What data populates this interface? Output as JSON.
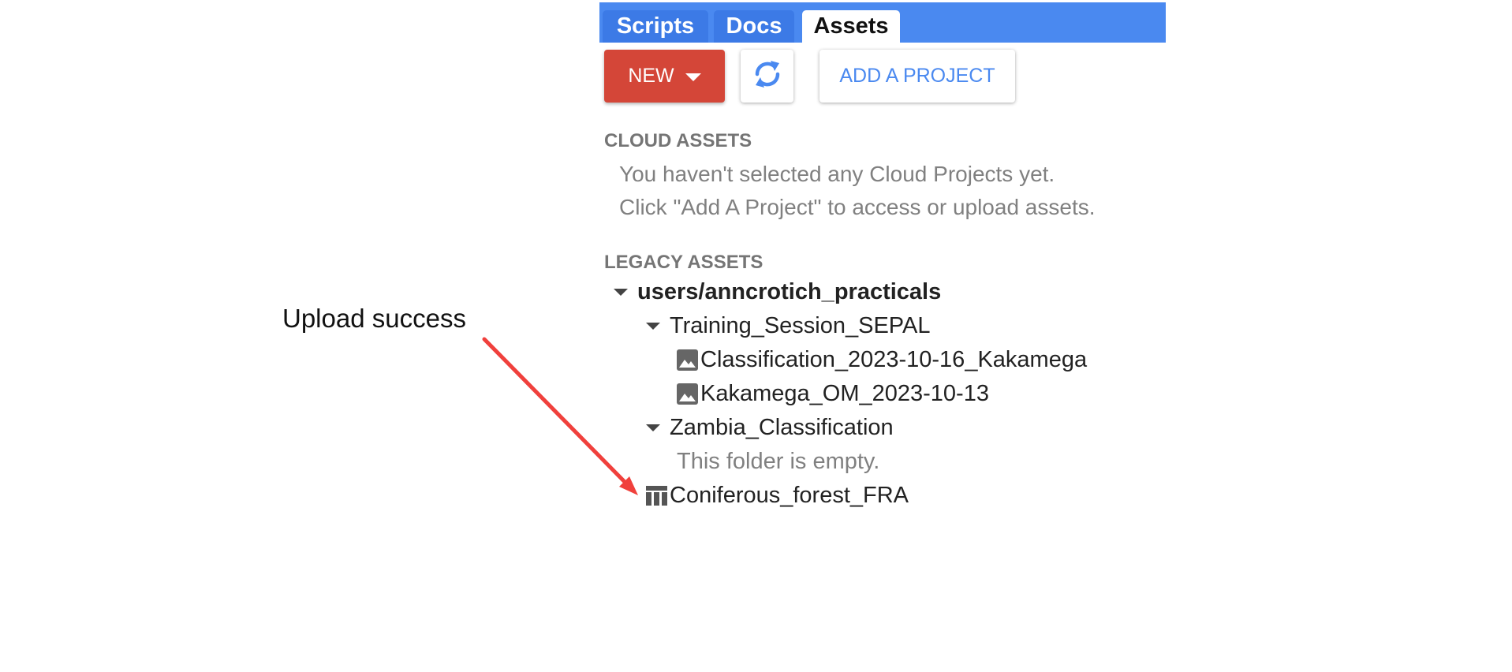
{
  "tabs": [
    {
      "label": "Scripts",
      "active": false
    },
    {
      "label": "Docs",
      "active": false
    },
    {
      "label": "Assets",
      "active": true
    }
  ],
  "toolbar": {
    "new_label": "NEW",
    "refresh_icon": "refresh-icon",
    "add_project_label": "ADD A PROJECT"
  },
  "cloud_assets": {
    "heading": "CLOUD ASSETS",
    "message_line1": "You haven't selected any Cloud Projects yet.",
    "message_line2": "Click \"Add A Project\" to access or upload assets."
  },
  "legacy_assets": {
    "heading": "LEGACY ASSETS",
    "root": "users/anncrotich_practicals",
    "folder1": {
      "name": "Training_Session_SEPAL",
      "items": [
        "Classification_2023-10-16_Kakamega",
        "Kakamega_OM_2023-10-13"
      ]
    },
    "folder2": {
      "name": "Zambia_Classification",
      "empty_message": "This folder is empty."
    },
    "table_asset": "Coniferous_forest_FRA"
  },
  "annotation": {
    "text": "Upload success"
  },
  "colors": {
    "tab_bar": "#4a89f0",
    "new_button": "#d44638",
    "accent_blue": "#4a89f0",
    "arrow": "#f0403c"
  }
}
